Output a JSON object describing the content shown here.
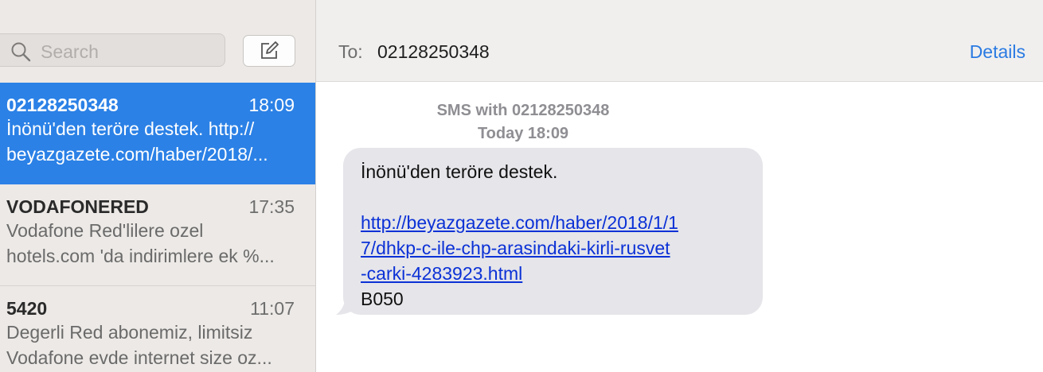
{
  "sidebar": {
    "search": {
      "placeholder": "Search"
    },
    "conversations": [
      {
        "name": "02128250348",
        "time": "18:09",
        "preview_line1": "İnönü'den teröre destek.  http://",
        "preview_line2": "beyazgazete.com/haber/2018/...",
        "selected": true
      },
      {
        "name": "VODAFONERED",
        "time": "17:35",
        "preview_line1": "Vodafone Red'lilere ozel",
        "preview_line2": "hotels.com 'da indirimlere ek %...",
        "selected": false
      },
      {
        "name": "5420",
        "time": "11:07",
        "preview_line1": "Degerli Red abonemiz, limitsiz",
        "preview_line2": "Vodafone evde internet size oz...",
        "selected": false
      }
    ]
  },
  "header": {
    "to_label": "To:",
    "to_number": "02128250348",
    "details_label": "Details"
  },
  "conversation": {
    "service_line": "SMS with 02128250348",
    "timestamp_line": "Today 18:09",
    "message": {
      "text_line1": "İnönü'den teröre destek.",
      "link_part1": "http://beyazgazete.com/haber/2018/1/1",
      "link_part2": "7/dhkp-c-ile-chp-arasindaki-kirli-rusvet",
      "link_part3": "-carki-4283923.html",
      "text_line_last": "B050"
    }
  },
  "icons": {
    "search": "search-icon",
    "compose": "compose-icon"
  },
  "colors": {
    "accent": "#2b81e6",
    "link": "#0b31d6",
    "details": "#2a7ae2",
    "bubble": "#e5e5ea"
  }
}
